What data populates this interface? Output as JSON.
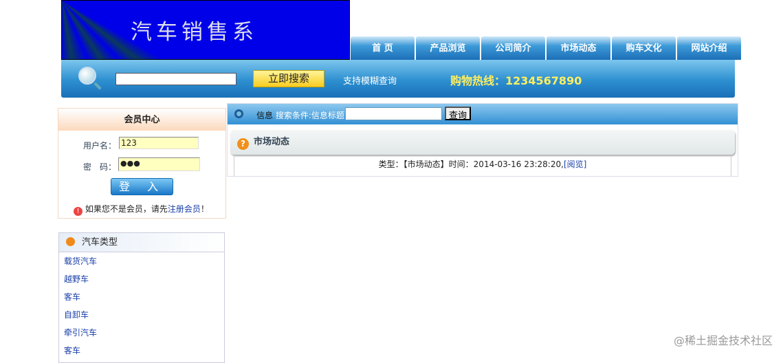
{
  "banner": {
    "title": "汽车销售系"
  },
  "nav": [
    "首 页",
    "产品浏览",
    "公司简介",
    "市场动态",
    "购车文化",
    "网站介绍"
  ],
  "search": {
    "value": "",
    "button": "立即搜索",
    "hint": "支持模糊查询",
    "hotline": "购物热线：1234567890"
  },
  "login": {
    "title": "会员中心",
    "username_label": "用户名：",
    "username": "123",
    "password_label": "密　码：",
    "password": "●●●",
    "button": "登 入",
    "note_prefix": "如果您不是会员，请先",
    "register_link": "注册会员",
    "note_suffix": "！"
  },
  "categories": {
    "title": "汽车类型",
    "items": [
      "载货汽车",
      "越野车",
      "客车",
      "自卸车",
      "牵引汽车",
      "客车"
    ]
  },
  "main": {
    "bar_label": "信息",
    "bar_condition": "搜索条件:信息标题",
    "query_button": "查询",
    "section_title": "市场动态",
    "item_text": "类型：【市场动态】时间：2014-03-16 23:28:20,",
    "item_link": "[阅览]"
  },
  "watermark": "@稀土掘金技术社区"
}
